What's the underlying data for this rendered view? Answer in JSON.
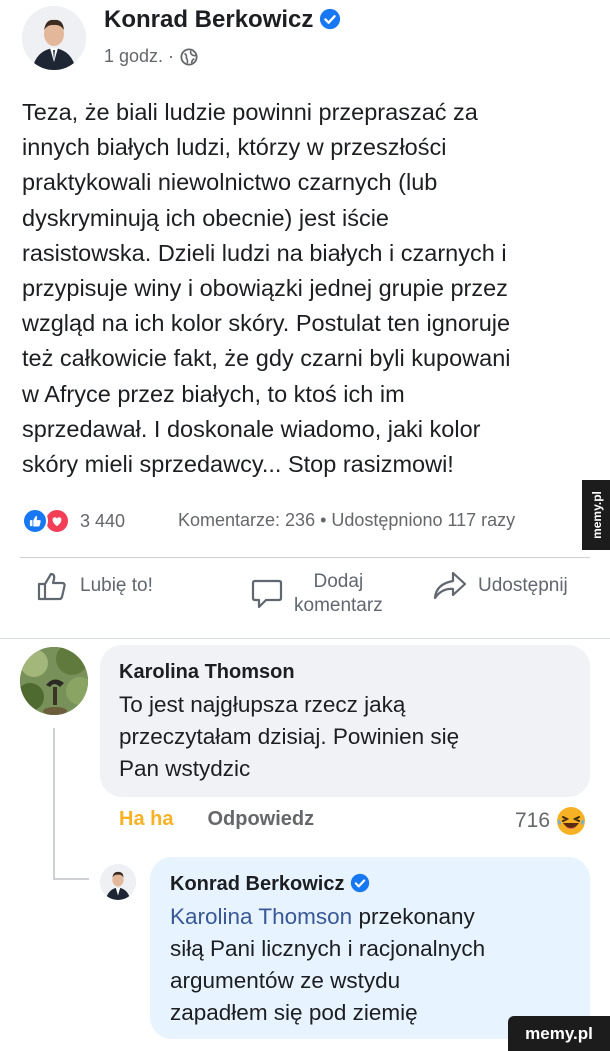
{
  "post": {
    "author": "Konrad Berkowicz",
    "time": "1 godz. ·",
    "text": "Teza, że biali ludzie powinni przepraszać za\ninnych białych ludzi, którzy w przeszłości\npraktykowali niewolnictwo czarnych (lub\ndyskryminują ich obecnie) jest iście\nrasistowska. Dzieli ludzi na białych i czarnych i\nprzypisuje winy i obowiązki jednej grupie przez\nwzgląd na ich kolor skóry. Postulat ten ignoruje\nteż całkowicie fakt, że gdy czarni byli kupowani\nw Afryce przez białych, to ktoś ich im\nsprzedawał. I doskonale wiadomo, jaki kolor\nskóry mieli sprzedawcy... Stop rasizmowi!",
    "reactions_count": "3 440",
    "comments_shares": "Komentarze: 236 • Udostępniono 117 razy"
  },
  "actions": {
    "like": "Lubię to!",
    "comment_line1": "Dodaj",
    "comment_line2": "komentarz",
    "share": "Udostępnij"
  },
  "comment": {
    "author": "Karolina Thomson",
    "text": "To jest najgłupsza rzecz jaką\nprzeczytałam dzisiaj. Powinien się\nPan wstydzic",
    "reaction_label": "Ha ha",
    "reply_label": "Odpowiedz",
    "reaction_count": "716"
  },
  "reply": {
    "author": "Konrad Berkowicz",
    "mention": "Karolina Thomson",
    "text_line1": " przekonany",
    "text_rest": "siłą Pani licznych i racjonalnych\nargumentów ze wstydu\nzapadłem się pod ziemię"
  },
  "watermark": {
    "side": "memy.pl",
    "bottom": "memy.pl"
  },
  "colors": {
    "verified": "#1877f2",
    "like_blue": "#1877f2",
    "love_red": "#f33e58",
    "haha_yellow": "#f7b125",
    "mention": "#385898",
    "reply_bubble": "#e7f3ff",
    "comment_bubble": "#f0f2f5"
  },
  "icons": [
    "verified-badge-icon",
    "globe-icon",
    "like-reaction-icon",
    "love-reaction-icon",
    "thumbs-up-icon",
    "comment-icon",
    "share-icon",
    "haha-emoji-icon"
  ]
}
